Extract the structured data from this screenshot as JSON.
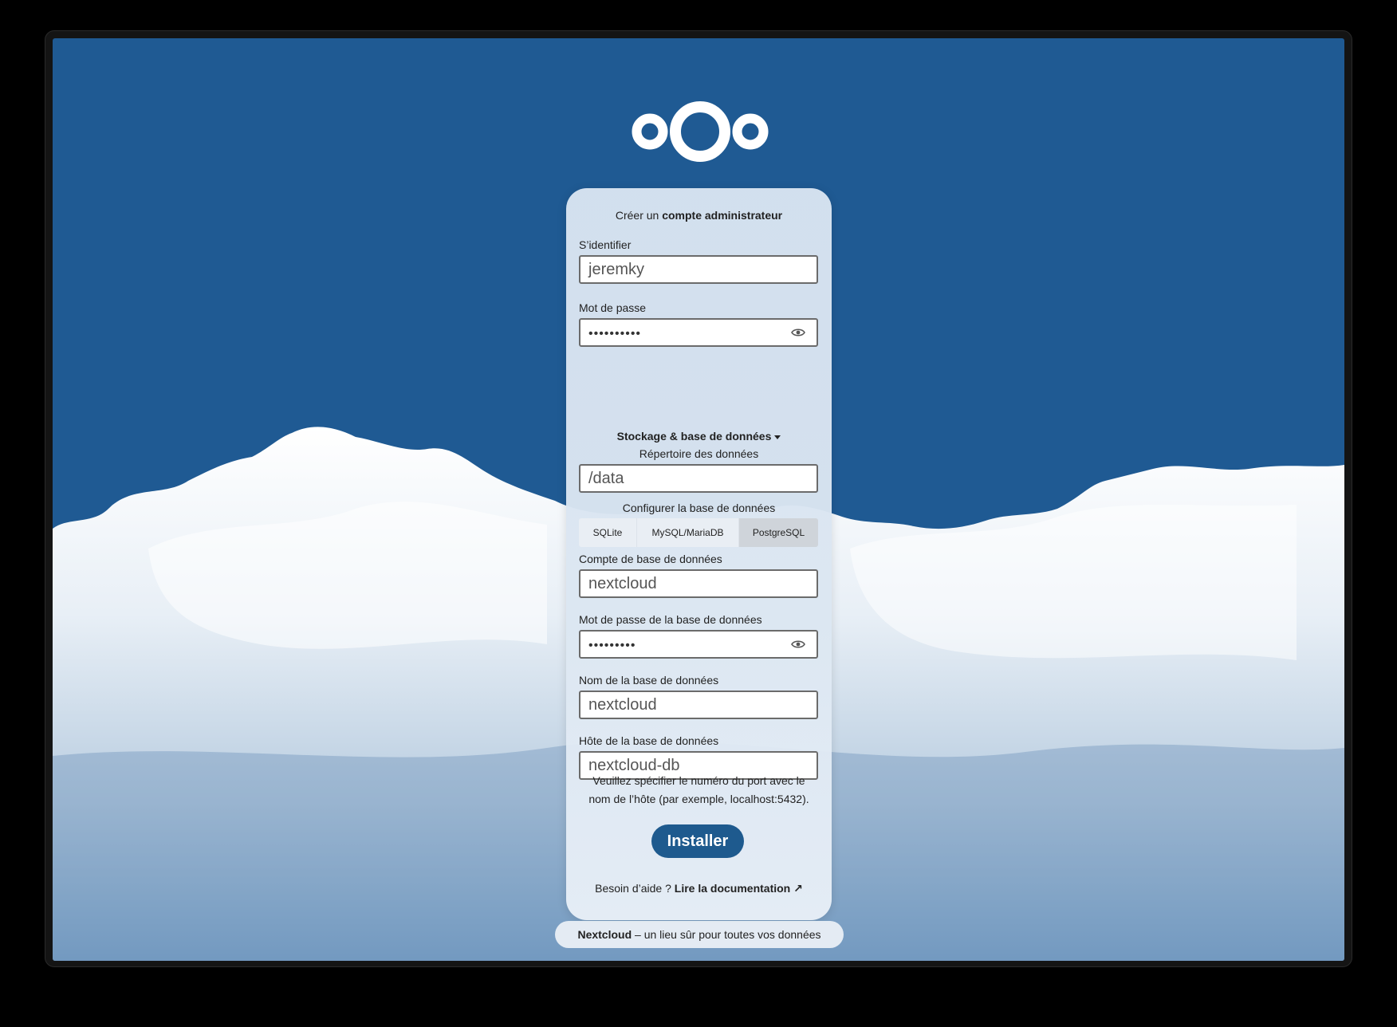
{
  "logo": {
    "name": "Nextcloud logo",
    "color": "#ffffff"
  },
  "colors": {
    "background": "#1f5a93",
    "accent": "#1e5a8e"
  },
  "admin": {
    "heading_prefix": "Créer un",
    "heading_bold": "compte administrateur",
    "username_label": "S’identifier",
    "username_value": "jeremky",
    "password_label": "Mot de passe",
    "password_value": "••••••••••"
  },
  "storage": {
    "section_title": "Stockage & base de données",
    "data_dir_label": "Répertoire des données",
    "data_dir_value": "/data",
    "db_config_label": "Configurer la base de données",
    "db_options": [
      "SQLite",
      "MySQL/MariaDB",
      "PostgreSQL"
    ],
    "db_selected": "PostgreSQL",
    "db_user_label": "Compte de base de données",
    "db_user_value": "nextcloud",
    "db_password_label": "Mot de passe de la base de données",
    "db_password_value": "•••••••••",
    "db_name_label": "Nom de la base de données",
    "db_name_value": "nextcloud",
    "db_host_label": "Hôte de la base de données",
    "db_host_value": "nextcloud-db",
    "hint_line1": "Veuillez spécifier le numéro du port avec le",
    "hint_line2": "nom de l’hôte (par exemple, localhost:5432)."
  },
  "install_button": "Installer",
  "help": {
    "prefix": "Besoin d’aide ?",
    "link": "Lire la documentation ↗"
  },
  "footer": {
    "brand": "Nextcloud",
    "tagline": "– un lieu sûr pour toutes vos données"
  }
}
